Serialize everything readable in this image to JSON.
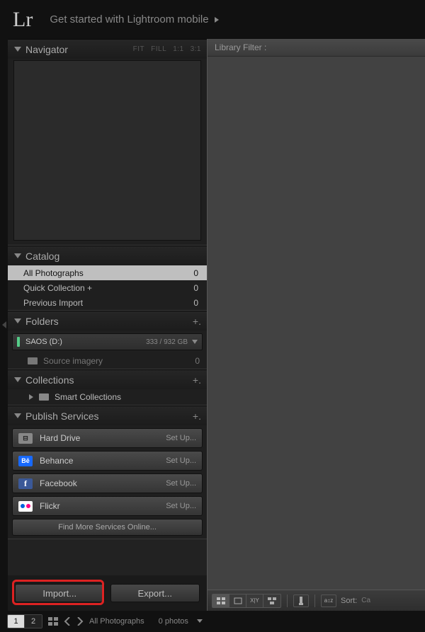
{
  "header": {
    "logo": "Lr",
    "mobile": "Get started with Lightroom mobile"
  },
  "navigator": {
    "title": "Navigator",
    "opts": [
      "FIT",
      "FILL",
      "1:1",
      "3:1"
    ]
  },
  "catalog": {
    "title": "Catalog",
    "items": [
      {
        "name": "All Photographs",
        "count": "0",
        "sel": true
      },
      {
        "name": "Quick Collection  +",
        "count": "0",
        "sel": false
      },
      {
        "name": "Previous Import",
        "count": "0",
        "sel": false
      }
    ]
  },
  "folders": {
    "title": "Folders",
    "drive": {
      "name": "SAOS (D:)",
      "size": "333 / 932 GB"
    },
    "sub": {
      "name": "Source imagery",
      "count": "0"
    }
  },
  "collections": {
    "title": "Collections",
    "smart": "Smart Collections"
  },
  "publish": {
    "title": "Publish Services",
    "items": [
      {
        "name": "Hard Drive",
        "action": "Set Up...",
        "icon": "hd"
      },
      {
        "name": "Behance",
        "action": "Set Up...",
        "icon": "be"
      },
      {
        "name": "Facebook",
        "action": "Set Up...",
        "icon": "fb"
      },
      {
        "name": "Flickr",
        "action": "Set Up...",
        "icon": "fl"
      }
    ],
    "find": "Find More Services Online..."
  },
  "buttons": {
    "import": "Import...",
    "export": "Export..."
  },
  "filter": {
    "label": "Library Filter :"
  },
  "toolbar": {
    "sort": "Sort:"
  },
  "film": {
    "m1": "1",
    "m2": "2",
    "path": "All Photographs",
    "count": "0 photos"
  }
}
